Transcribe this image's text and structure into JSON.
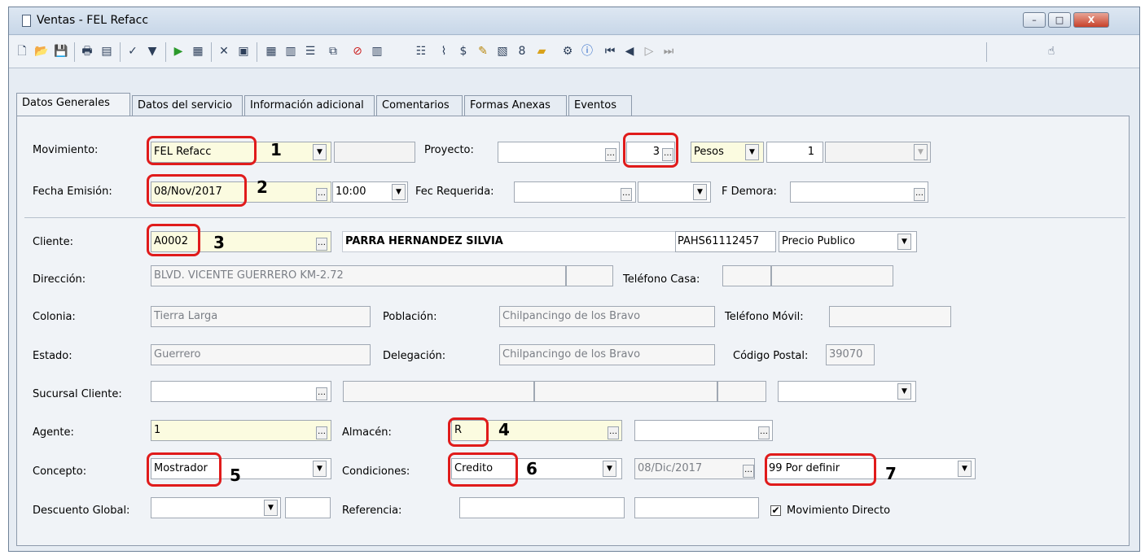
{
  "window": {
    "title": "Ventas - FEL Refacc",
    "minimize_glyph": "–",
    "maximize_glyph": "□",
    "close_glyph": "X"
  },
  "toolbar": {
    "icons": [
      "new-document-icon",
      "open-folder-icon",
      "save-icon",
      "print-icon",
      "preview-icon",
      "spellcheck-icon",
      "filter-icon",
      "play-icon",
      "cfdi-icon",
      "delete-icon",
      "clipboard-icon",
      "grid-icon",
      "form-icon",
      "list-icon",
      "copy-icon",
      "cancel-icon",
      "barcode-icon",
      "checklist-icon",
      "attachment-icon",
      "currency-icon",
      "validate-icon",
      "report-icon",
      "agent-icon",
      "folder-icon",
      "properties-icon",
      "info-icon",
      "first-record-icon",
      "previous-record-icon",
      "next-record-icon",
      "last-record-icon",
      "pointer-icon"
    ]
  },
  "tabs": [
    {
      "label": "Datos Generales"
    },
    {
      "label": "Datos del servicio"
    },
    {
      "label": "Información adicional"
    },
    {
      "label": "Comentarios"
    },
    {
      "label": "Formas Anexas"
    },
    {
      "label": "Eventos"
    }
  ],
  "form": {
    "movimiento": {
      "label": "Movimiento:",
      "value": "FEL Refacc",
      "extra": ""
    },
    "proyecto": {
      "label": "Proyecto:",
      "value": "",
      "number": "3",
      "moneda": "Pesos",
      "tipo_cambio": "1",
      "extra": ""
    },
    "fecha_emision": {
      "label": "Fecha Emisión:",
      "value": "08/Nov/2017",
      "hora": "10:00"
    },
    "fec_requerida": {
      "label": "Fec Requerida:",
      "value": "",
      "extra": ""
    },
    "f_demora": {
      "label": "F Demora:",
      "value": ""
    },
    "cliente": {
      "label": "Cliente:",
      "value": "A0002",
      "nombre": "PARRA HERNANDEZ SILVIA",
      "rfc": "PAHS61112457",
      "lista_precios": "Precio Publico"
    },
    "direccion": {
      "label": "Dirección:",
      "value": "BLVD. VICENTE GUERRERO KM-2.72",
      "extra": ""
    },
    "telefono_casa": {
      "label": "Teléfono Casa:",
      "value": "",
      "extra": ""
    },
    "colonia": {
      "label": "Colonia:",
      "value": "Tierra Larga"
    },
    "poblacion": {
      "label": "Población:",
      "value": "Chilpancingo de los Bravo"
    },
    "telefono_movil": {
      "label": "Teléfono Móvil:",
      "value": ""
    },
    "estado": {
      "label": "Estado:",
      "value": "Guerrero"
    },
    "delegacion": {
      "label": "Delegación:",
      "value": "Chilpancingo de los Bravo"
    },
    "codigo_postal": {
      "label": "Código Postal:",
      "value": "39070"
    },
    "sucursal_cliente": {
      "label": "Sucursal Cliente:",
      "value": "",
      "extra1": "",
      "extra2": "",
      "extra3": "",
      "extra4": ""
    },
    "agente": {
      "label": "Agente:",
      "value": "1"
    },
    "almacen": {
      "label": "Almacén:",
      "value": "R",
      "extra": ""
    },
    "concepto": {
      "label": "Concepto:",
      "value": "Mostrador"
    },
    "condiciones": {
      "label": "Condiciones:",
      "value": "Credito",
      "vencimiento": "08/Dic/2017",
      "forma_pago": "99 Por definir"
    },
    "descuento_global": {
      "label": "Descuento Global:",
      "value": "",
      "extra": ""
    },
    "referencia": {
      "label": "Referencia:",
      "value": "",
      "extra": ""
    },
    "movimiento_directo": {
      "label": "Movimiento Directo",
      "checked": true,
      "check_glyph": "✔"
    }
  },
  "annotations": {
    "n1": "1",
    "n2": "2",
    "n3": "3",
    "n4": "4",
    "n5": "5",
    "n6": "6",
    "n7": "7"
  },
  "colors": {
    "highlight": "#e01b1b",
    "required_field": "#fbfbe0"
  }
}
